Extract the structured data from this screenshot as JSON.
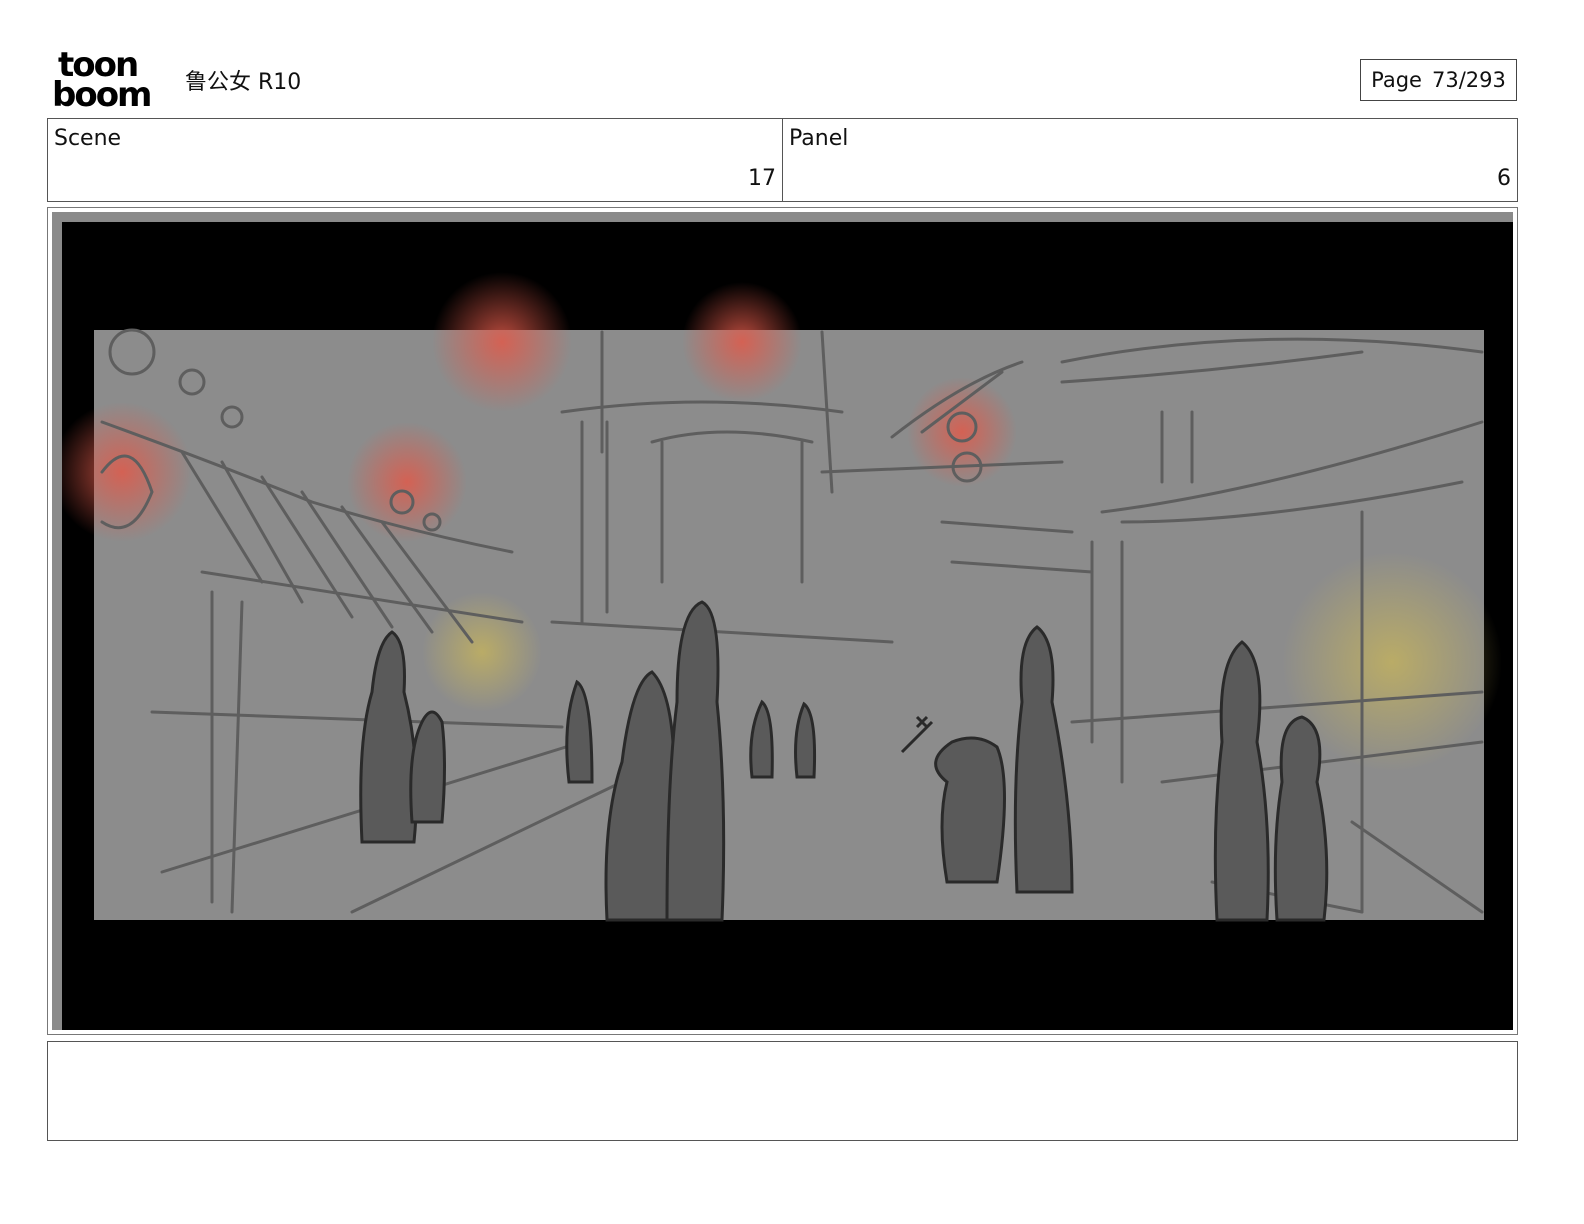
{
  "header": {
    "logo_top": "toon",
    "logo_bottom": "boom",
    "title": "鲁公女 R10",
    "page_label": "Page",
    "page_value": "73/293"
  },
  "meta": {
    "scene_label": "Scene",
    "scene_value": "17",
    "panel_label": "Panel",
    "panel_value": "6"
  },
  "notes": {
    "text": ""
  }
}
